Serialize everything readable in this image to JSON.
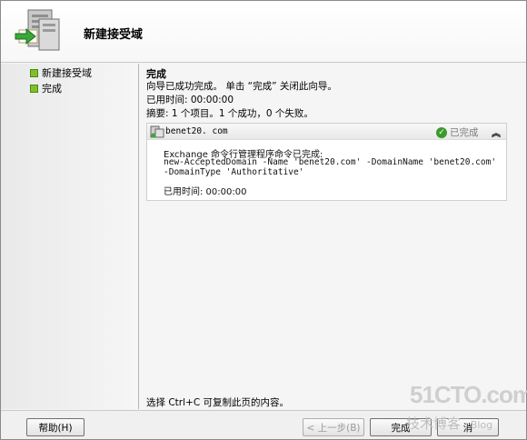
{
  "header": {
    "title": "新建接受域"
  },
  "steps": [
    {
      "label": "新建接受域"
    },
    {
      "label": "完成"
    }
  ],
  "main": {
    "section_title": "完成",
    "intro": "向导已成功完成。 单击 “完成” 关闭此向导。",
    "elapsed": "已用时间: 00:00:00",
    "summary": "摘要: 1 个项目。1 个成功，0 个失败。",
    "result": {
      "name": "benet20. com",
      "status": "已完成",
      "command_label": "Exchange 命令行管理程序命令已完成:",
      "command_line1": "new-AcceptedDomain -Name 'benet20.com' -DomainName 'benet20.com'",
      "command_line2": "-DomainType 'Authoritative'",
      "elapsed": "已用时间: 00:00:00"
    },
    "hint": "选择 Ctrl+C 可复制此页的内容。"
  },
  "footer": {
    "help": "帮助(H)",
    "back": "< 上一步(B)",
    "finish": "完成",
    "cancel": "消"
  },
  "watermark": {
    "site": "51CTO.com",
    "tagline": "技术博客",
    "blog": "Blog"
  }
}
